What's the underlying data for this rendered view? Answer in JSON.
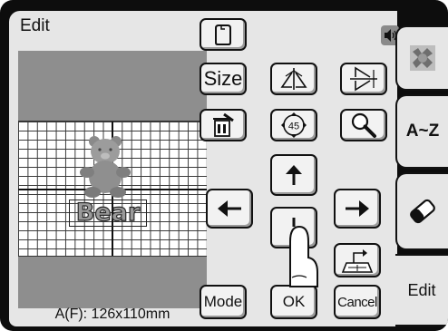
{
  "screen": {
    "title": "Edit",
    "size_readout": "A(F): 126x110mm"
  },
  "preview": {
    "design_text": "Bear"
  },
  "buttons": {
    "size": "Size",
    "mode": "Mode",
    "ok": "OK",
    "cancel": "Cancel"
  },
  "tabs": {
    "alphabet": "A~Z",
    "edit": "Edit"
  },
  "icons": [
    "frame-icon",
    "speaker-icon",
    "mirror-icon",
    "flip-icon",
    "delete-icon",
    "rotate-icon",
    "magnify-icon",
    "arrow-up-icon",
    "arrow-left-icon",
    "arrow-right-icon",
    "arrow-down-icon",
    "move-to-center-icon",
    "embroidery-pattern-icon",
    "eraser-icon",
    "finger-pointer-icon"
  ],
  "colors": {
    "bezel": "#0d0d0d",
    "panel": "#e6e6e6",
    "preview_bg": "#8e8e8e",
    "button_face": "#f2f2f2"
  }
}
